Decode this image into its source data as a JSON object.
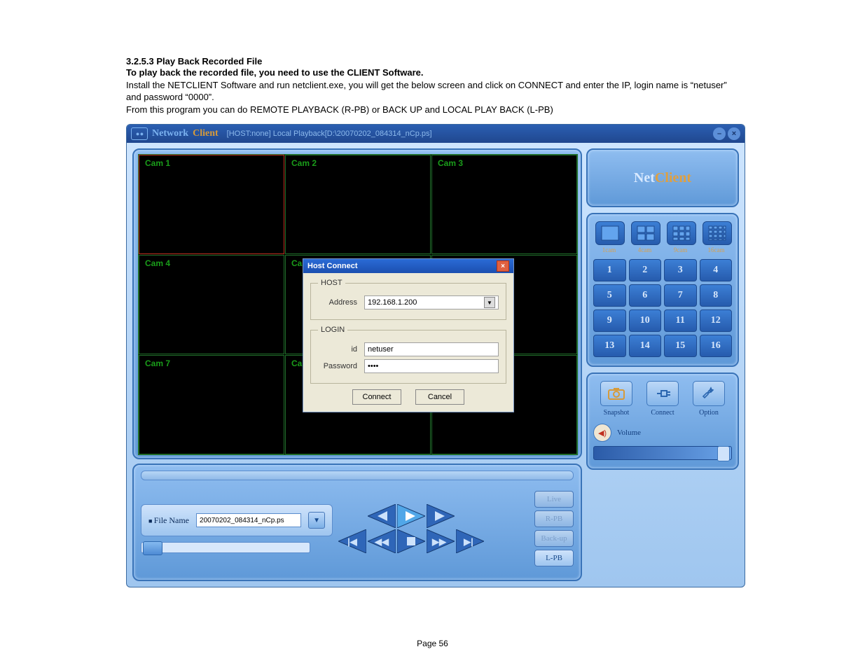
{
  "doc": {
    "heading": "3.2.5.3 Play Back Recorded File",
    "bold_line": "To play back the recorded file, you need to use the CLIENT Software.",
    "line1": "Install the NETCLIENT Software and run netclient.exe, you will get the below screen and click on CONNECT and enter the IP, login name is “netuser” and password “0000”.",
    "line2": "From this program you can do REMOTE PLAYBACK (R-PB) or BACK UP and LOCAL PLAY BACK (L-PB)",
    "page_num": "Page 56"
  },
  "app": {
    "titlebar": {
      "net": "Network",
      "client": "Client",
      "path": "[HOST:none] Local Playback[D:\\20070202_084314_nCp.ps]"
    },
    "cams": [
      "Cam  1",
      "Cam  2",
      "Cam  3",
      "Cam  4",
      "Ca",
      "",
      "Cam  7",
      "Ca",
      ""
    ],
    "dialog": {
      "title": "Host Connect",
      "host_legend": "HOST",
      "addr_label": "Address",
      "addr_value": "192.168.1.200",
      "login_legend": "LOGIN",
      "id_label": "id",
      "id_value": "netuser",
      "pw_label": "Password",
      "pw_value": "****",
      "connect": "Connect",
      "cancel": "Cancel"
    },
    "bottom": {
      "file_label": "File Name",
      "file_value": "20070202_084314_nCp.ps",
      "modes": {
        "live": "Live",
        "rpb": "R-PB",
        "backup": "Back-up",
        "lpb": "L-PB"
      }
    },
    "brand": {
      "net": "Net",
      "client": "Client"
    },
    "view_modes": [
      {
        "lbl": "1cam"
      },
      {
        "lbl": "4cam"
      },
      {
        "lbl": "9cam"
      },
      {
        "lbl": "16cam"
      }
    ],
    "numbers": [
      "1",
      "2",
      "3",
      "4",
      "5",
      "6",
      "7",
      "8",
      "9",
      "10",
      "11",
      "12",
      "13",
      "14",
      "15",
      "16"
    ],
    "tools": {
      "snapshot": "Snapshot",
      "connect": "Connect",
      "option": "Option"
    },
    "volume_label": "Volume"
  }
}
